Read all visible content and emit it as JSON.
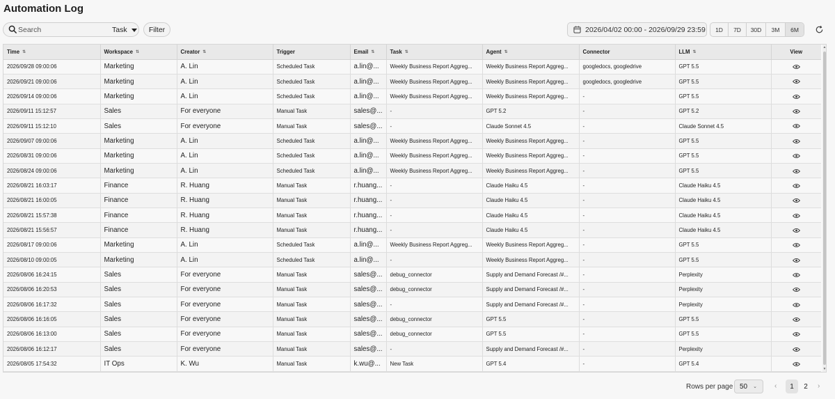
{
  "title": "Automation Log",
  "search": {
    "placeholder": "Search",
    "scope": "Task"
  },
  "filter_label": "Filter",
  "date_range": "2026/04/02 00:00 - 2026/09/29 23:59",
  "ranges": [
    "1D",
    "7D",
    "30D",
    "3M",
    "6M"
  ],
  "active_range": "6M",
  "columns": [
    "Time",
    "Workspace",
    "Creator",
    "Trigger",
    "Email",
    "Task",
    "Agent",
    "Connector",
    "LLM",
    "View"
  ],
  "rows": [
    [
      "2026/09/28 09:00:06",
      "Marketing",
      "A. Lin",
      "Scheduled Task",
      "a.lin@...",
      "Weekly Business Report Aggreg...",
      "Weekly Business Report Aggreg...",
      "googledocs, googledrive",
      "GPT 5.5"
    ],
    [
      "2026/09/21 09:00:06",
      "Marketing",
      "A. Lin",
      "Scheduled Task",
      "a.lin@...",
      "Weekly Business Report Aggreg...",
      "Weekly Business Report Aggreg...",
      "googledocs, googledrive",
      "GPT 5.5"
    ],
    [
      "2026/09/14 09:00:06",
      "Marketing",
      "A. Lin",
      "Scheduled Task",
      "a.lin@...",
      "Weekly Business Report Aggreg...",
      "Weekly Business Report Aggreg...",
      "-",
      "GPT 5.5"
    ],
    [
      "2026/09/11 15:12:57",
      "Sales",
      "For everyone",
      "Manual Task",
      "sales@...",
      "-",
      "GPT 5.2",
      "-",
      "GPT 5.2"
    ],
    [
      "2026/09/11 15:12:10",
      "Sales",
      "For everyone",
      "Manual Task",
      "sales@...",
      "-",
      "Claude Sonnet 4.5",
      "-",
      "Claude Sonnet 4.5"
    ],
    [
      "2026/09/07 09:00:06",
      "Marketing",
      "A. Lin",
      "Scheduled Task",
      "a.lin@...",
      "Weekly Business Report Aggreg...",
      "Weekly Business Report Aggreg...",
      "-",
      "GPT 5.5"
    ],
    [
      "2026/08/31 09:00:06",
      "Marketing",
      "A. Lin",
      "Scheduled Task",
      "a.lin@...",
      "Weekly Business Report Aggreg...",
      "Weekly Business Report Aggreg...",
      "-",
      "GPT 5.5"
    ],
    [
      "2026/08/24 09:00:06",
      "Marketing",
      "A. Lin",
      "Scheduled Task",
      "a.lin@...",
      "Weekly Business Report Aggreg...",
      "Weekly Business Report Aggreg...",
      "-",
      "GPT 5.5"
    ],
    [
      "2026/08/21 16:03:17",
      "Finance",
      "R. Huang",
      "Manual Task",
      "r.huang...",
      "-",
      "Claude Haiku 4.5",
      "-",
      "Claude Haiku 4.5"
    ],
    [
      "2026/08/21 16:00:05",
      "Finance",
      "R. Huang",
      "Manual Task",
      "r.huang...",
      "-",
      "Claude Haiku 4.5",
      "-",
      "Claude Haiku 4.5"
    ],
    [
      "2026/08/21 15:57:38",
      "Finance",
      "R. Huang",
      "Manual Task",
      "r.huang...",
      "-",
      "Claude Haiku 4.5",
      "-",
      "Claude Haiku 4.5"
    ],
    [
      "2026/08/21 15:56:57",
      "Finance",
      "R. Huang",
      "Manual Task",
      "r.huang...",
      "-",
      "Claude Haiku 4.5",
      "-",
      "Claude Haiku 4.5"
    ],
    [
      "2026/08/17 09:00:06",
      "Marketing",
      "A. Lin",
      "Scheduled Task",
      "a.lin@...",
      "Weekly Business Report Aggreg...",
      "Weekly Business Report Aggreg...",
      "-",
      "GPT 5.5"
    ],
    [
      "2026/08/10 09:00:05",
      "Marketing",
      "A. Lin",
      "Scheduled Task",
      "a.lin@...",
      "-",
      "Weekly Business Report Aggreg...",
      "-",
      "GPT 5.5"
    ],
    [
      "2026/08/06 16:24:15",
      "Sales",
      "For everyone",
      "Manual Task",
      "sales@...",
      "debug_connector",
      "Supply and Demand Forecast /#...",
      "-",
      "Perplexity"
    ],
    [
      "2026/08/06 16:20:53",
      "Sales",
      "For everyone",
      "Manual Task",
      "sales@...",
      "debug_connector",
      "Supply and Demand Forecast /#...",
      "-",
      "Perplexity"
    ],
    [
      "2026/08/06 16:17:32",
      "Sales",
      "For everyone",
      "Manual Task",
      "sales@...",
      "-",
      "Supply and Demand Forecast /#...",
      "-",
      "Perplexity"
    ],
    [
      "2026/08/06 16:16:05",
      "Sales",
      "For everyone",
      "Manual Task",
      "sales@...",
      "debug_connector",
      "GPT 5.5",
      "-",
      "GPT 5.5"
    ],
    [
      "2026/08/06 16:13:00",
      "Sales",
      "For everyone",
      "Manual Task",
      "sales@...",
      "debug_connector",
      "GPT 5.5",
      "-",
      "GPT 5.5"
    ],
    [
      "2026/08/06 16:12:17",
      "Sales",
      "For everyone",
      "Manual Task",
      "sales@...",
      "-",
      "Supply and Demand Forecast /#...",
      "-",
      "Perplexity"
    ],
    [
      "2026/08/05 17:54:32",
      "IT Ops",
      "K. Wu",
      "Manual Task",
      "k.wu@...",
      "New Task",
      "GPT 5.4",
      "-",
      "GPT 5.4"
    ]
  ],
  "footer": {
    "rows_per_page_label": "Rows per page",
    "rows_per_page": "50",
    "pages": [
      "1",
      "2"
    ],
    "current_page": "1"
  }
}
